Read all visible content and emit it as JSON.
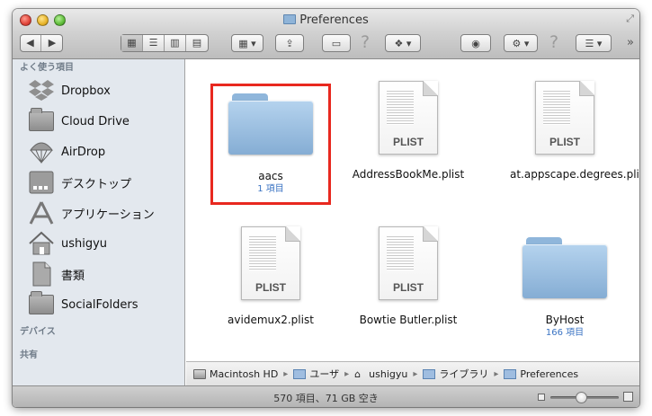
{
  "window": {
    "title": "Preferences"
  },
  "sidebar": {
    "favorites_header": "よく使う項目",
    "devices_header": "デバイス",
    "shared_header": "共有",
    "items": [
      {
        "label": "Dropbox",
        "icon": "dropbox-icon"
      },
      {
        "label": "Cloud Drive",
        "icon": "folder-icon"
      },
      {
        "label": "AirDrop",
        "icon": "airdrop-icon"
      },
      {
        "label": "デスクトップ",
        "icon": "desktop-icon"
      },
      {
        "label": "アプリケーション",
        "icon": "applications-icon"
      },
      {
        "label": "ushigyu",
        "icon": "home-icon"
      },
      {
        "label": "書類",
        "icon": "documents-icon"
      },
      {
        "label": "SocialFolders",
        "icon": "folder-icon"
      }
    ]
  },
  "files": [
    {
      "name": "aacs",
      "kind": "folder",
      "count": "1 項目",
      "selected": true
    },
    {
      "name": "AddressBookMe.plist",
      "kind": "plist",
      "tag": "PLIST"
    },
    {
      "name": "at.appscape.degrees.plist",
      "kind": "plist",
      "tag": "PLIST"
    },
    {
      "name": "avidemux2.plist",
      "kind": "plist",
      "tag": "PLIST"
    },
    {
      "name": "Bowtie Butler.plist",
      "kind": "plist",
      "tag": "PLIST"
    },
    {
      "name": "ByHost",
      "kind": "folder",
      "count": "166 項目"
    }
  ],
  "path": [
    "Macintosh HD",
    "ユーザ",
    "ushigyu",
    "ライブラリ",
    "Preferences"
  ],
  "status": {
    "text": "570 項目、71 GB 空き",
    "icon_size_level": 0.45
  },
  "colors": {
    "selection_outline": "#e8281f",
    "count_text": "#3a73c3",
    "sidebar_bg": "#e3e8ee"
  }
}
